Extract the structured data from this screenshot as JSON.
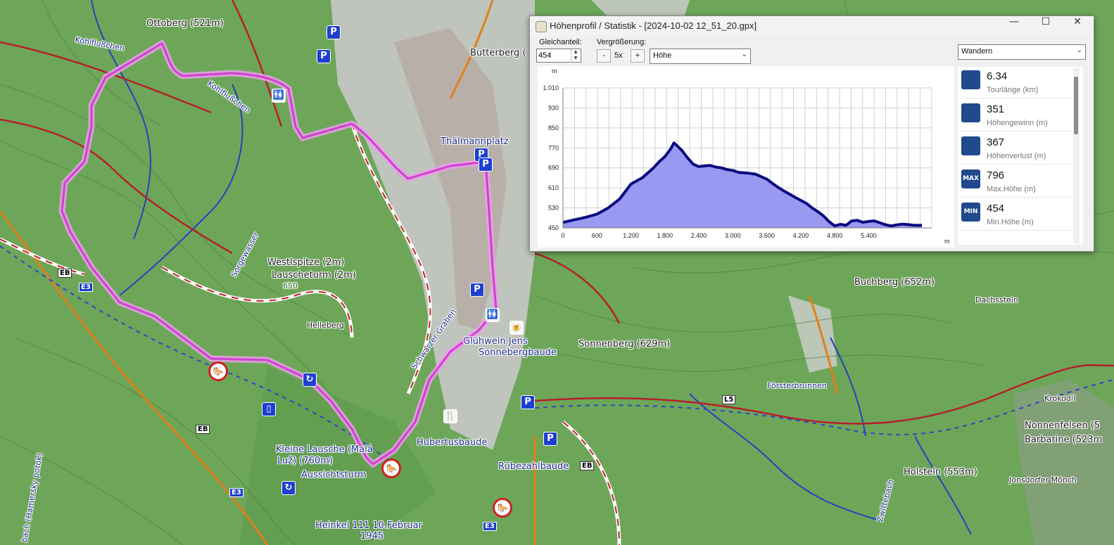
{
  "map": {
    "labels": {
      "ottoberg": "Ottoberg (521m)",
      "kohlflusschen": "Kohlflußchen",
      "kohlflusschen2": "Kohlflußchen",
      "butterberg": "Butterberg (",
      "thalmannplatz": "Thälmannplatz",
      "westlspitze": "Westlspitze (2m)",
      "lauscheturm": "Lauscheturm (2m)",
      "helleberg": "Helleberg",
      "schwarzer_graben": "Schwarzer Graben",
      "gluehwein": "Glühwein Jens",
      "sonnebergbaude": "Sonnebergbaude",
      "sonnenberg": "Sonnenberg (629m)",
      "buchberg": "Buchberg (652m)",
      "dachsstein": "Dachsstein",
      "foersterbrunnen": "Försterbrunnen",
      "hubertusbaude": "Hubertusbaude",
      "kleine_lausche": "Kleine Lausche (Malá",
      "kleine_lausche2": "Luž) (760m)",
      "aussichtsturm": "Aussichtsturm",
      "ruebezahlbaude": "Rübezahlbaude",
      "heinkel1": "Heinkel 111 10.Februar",
      "heinkel2": "1945",
      "holstein": "Holstein (553m)",
      "nonnenfelsen": "Nonnenfelsen (5",
      "barbarine": "Barbarine (523m",
      "krokodil": "Krokodil",
      "jonsdorfer": "Jonsdorfer Mönch",
      "bach": "bach (Hamersky potok)",
      "zwittebach": "Zwittebach",
      "sorgewasser": "Sorgewasser",
      "num650": "650"
    },
    "signs": {
      "eb": "EB",
      "e3": "E3",
      "l5": "L5"
    }
  },
  "window": {
    "title": "Höhenprofil / Statistik - [2024-10-02 12_51_20.gpx]",
    "gleichanteil_label": "Gleichanteil:",
    "gleichanteil_value": "454",
    "zoom_label": "Vergrößerung:",
    "zoom_minus": "-",
    "zoom_value": "5x",
    "zoom_plus": "+",
    "mode_selected": "Höhe",
    "activity_selected": "Wandern",
    "minimize": "—",
    "maximize": "☐",
    "close": "✕"
  },
  "stats": [
    {
      "value": "6.34",
      "caption": "Tourlänge (km)",
      "icon": "route-length-icon"
    },
    {
      "value": "351",
      "caption": "Höhengewinn (m)",
      "icon": "elevation-gain-icon"
    },
    {
      "value": "367",
      "caption": "Höhenverlust (m)",
      "icon": "elevation-loss-icon"
    },
    {
      "value": "796",
      "caption": "Max.Höhe (m)",
      "icon": "max-elevation-icon",
      "badge": "MAX"
    },
    {
      "value": "454",
      "caption": "Min.Höhe (m)",
      "icon": "min-elevation-icon",
      "badge": "MIN"
    }
  ],
  "chart_data": {
    "type": "area",
    "xlabel": "m",
    "ylabel": "m",
    "xlim": [
      0,
      6340
    ],
    "ylim": [
      450,
      1010
    ],
    "x_ticks": [
      "0",
      "600",
      "1.200",
      "1.800",
      "2.400",
      "3.000",
      "3.600",
      "4.200",
      "4.800",
      "5.400"
    ],
    "x_tick_values": [
      0,
      600,
      1200,
      1800,
      2400,
      3000,
      3600,
      4200,
      4800,
      5400
    ],
    "y_ticks": [
      "450",
      "530",
      "610",
      "690",
      "770",
      "850",
      "930",
      "1.010"
    ],
    "y_tick_values": [
      450,
      530,
      610,
      690,
      770,
      850,
      930,
      1010
    ],
    "grid": true,
    "fill_color": "#9999f2",
    "line_color": "#0a0a80",
    "series": [
      {
        "x": [
          0,
          200,
          400,
          600,
          800,
          1000,
          1100,
          1200,
          1300,
          1400,
          1500,
          1600,
          1700,
          1800,
          1900,
          1960,
          2000,
          2100,
          2200,
          2300,
          2400,
          2500,
          2600,
          2700,
          2800,
          2900,
          3000,
          3100,
          3200,
          3300,
          3400,
          3500,
          3600,
          3700,
          3800,
          3900,
          4000,
          4100,
          4200,
          4300,
          4400,
          4500,
          4600,
          4700,
          4800,
          4900,
          5000,
          5100,
          5200,
          5300,
          5400,
          5500,
          5600,
          5700,
          5800,
          5900,
          6000,
          6100,
          6200,
          6340
        ],
        "values": [
          472,
          482,
          492,
          505,
          530,
          565,
          595,
          625,
          638,
          650,
          670,
          690,
          715,
          735,
          765,
          790,
          782,
          760,
          730,
          705,
          695,
          698,
          700,
          693,
          690,
          683,
          680,
          672,
          670,
          668,
          665,
          655,
          645,
          628,
          612,
          598,
          585,
          572,
          560,
          548,
          530,
          515,
          498,
          475,
          458,
          464,
          460,
          478,
          480,
          472,
          476,
          478,
          470,
          462,
          458,
          462,
          465,
          463,
          460,
          460
        ]
      }
    ]
  }
}
